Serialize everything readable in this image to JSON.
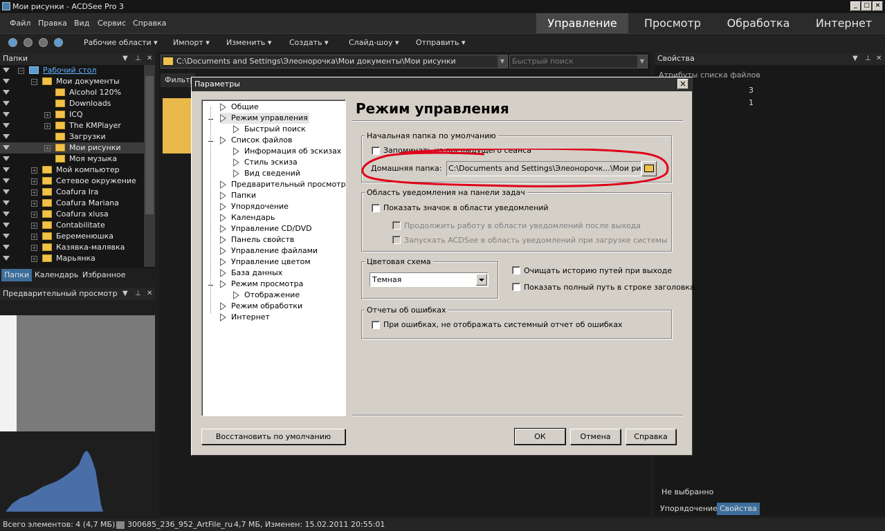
{
  "window": {
    "title": "Мои рисунки - ACDSee Pro 3",
    "min": "_",
    "max": "□",
    "close": "×"
  },
  "menu": [
    "Файл",
    "Правка",
    "Вид",
    "Сервис",
    "Справка"
  ],
  "mode_tabs": [
    "Управление",
    "Просмотр",
    "Обработка",
    "Интернет"
  ],
  "toolbar": [
    "Рабочие области ▾",
    "Импорт ▾",
    "Изменить ▾",
    "Создать ▾",
    "Слайд-шоу ▾",
    "Отправить ▾"
  ],
  "folders": {
    "title": "Папки",
    "items": [
      {
        "label": "Рабочий стол",
        "level": 0,
        "link": true
      },
      {
        "label": "Мои документы",
        "level": 1
      },
      {
        "label": "Alcohol 120%",
        "level": 2
      },
      {
        "label": "Downloads",
        "level": 2
      },
      {
        "label": "ICQ",
        "level": 2
      },
      {
        "label": "The KMPlayer",
        "level": 2
      },
      {
        "label": "Загрузки",
        "level": 2
      },
      {
        "label": "Мои рисунки",
        "level": 2,
        "selected": true
      },
      {
        "label": "Моя музыка",
        "level": 2
      },
      {
        "label": "Мой компьютер",
        "level": 1
      },
      {
        "label": "Сетевое окружение",
        "level": 1
      },
      {
        "label": "Coafura Ira",
        "level": 1
      },
      {
        "label": "Coafura Mariana",
        "level": 1
      },
      {
        "label": "Coafura xiusa",
        "level": 1
      },
      {
        "label": "Contabilitate",
        "level": 1
      },
      {
        "label": "Беременюшка",
        "level": 1
      },
      {
        "label": "Казявка-малявка",
        "level": 1
      },
      {
        "label": "Марьянка",
        "level": 1
      }
    ],
    "tabs": [
      "Папки",
      "Календарь",
      "Избранное"
    ]
  },
  "preview": {
    "title": "Предварительный просмотр"
  },
  "path": {
    "value": "C:\\Documents and Settings\\Элеонорочка\\Мои документы\\Мои рисунки",
    "filter": "Фильтр",
    "search_placeholder": "Быстрый поиск"
  },
  "properties": {
    "title": "Свойства",
    "section": "Атрибуты списка файлов",
    "v1": "3",
    "v2": "1",
    "none": "Не выбранно",
    "tabs": [
      "Упорядочение",
      "Свойства"
    ]
  },
  "status": {
    "count": "Всего элементов: 4  (4,7 МБ)",
    "file": "300685_236_952_ArtFile_ru",
    "info": "4,7 МБ, Изменен: 15.02.2011 20:55:01"
  },
  "dialog": {
    "title": "Параметры",
    "close": "×",
    "heading": "Режим управления",
    "nav": [
      {
        "label": "Общие",
        "level": 0
      },
      {
        "label": "Режим управления",
        "level": 0,
        "selected": true
      },
      {
        "label": "Быстрый поиск",
        "level": 1
      },
      {
        "label": "Список файлов",
        "level": 0
      },
      {
        "label": "Информация об эскизах",
        "level": 1
      },
      {
        "label": "Стиль эскиза",
        "level": 1
      },
      {
        "label": "Вид сведений",
        "level": 1
      },
      {
        "label": "Предварительный просмотр",
        "level": 0
      },
      {
        "label": "Папки",
        "level": 0
      },
      {
        "label": "Упорядочение",
        "level": 0
      },
      {
        "label": "Календарь",
        "level": 0
      },
      {
        "label": "Управление CD/DVD",
        "level": 0
      },
      {
        "label": "Панель свойств",
        "level": 0
      },
      {
        "label": "Управление файлами",
        "level": 0
      },
      {
        "label": "Управление цветом",
        "level": 0
      },
      {
        "label": "База данных",
        "level": 0
      },
      {
        "label": "Режим просмотра",
        "level": 0
      },
      {
        "label": "Отображение",
        "level": 1
      },
      {
        "label": "Режим обработки",
        "level": 0
      },
      {
        "label": "Интернет",
        "level": 0
      }
    ],
    "grp_start": "Начальная папка по умолчанию",
    "remember": "Запоминать из предыдущего сеанса",
    "home_label": "Домашняя папка:",
    "home_value": "C:\\Documents and Settings\\Элеонорочк...\\Мои рисунки",
    "grp_tray": "Область уведомления на панели задач",
    "tray_show": "Показать значок в области уведомлений",
    "tray_continue": "Продолжить работу в области уведомлений после выхода",
    "tray_launch": "Запускать ACDSee в область уведомлений при загрузке системы",
    "grp_color": "Цветовая схема",
    "color_value": "Темная",
    "clear_history": "Очищать историю путей при выходе",
    "full_path": "Показать полный путь в строке заголовка",
    "grp_errors": "Отчеты об ошибках",
    "errors_opt": "При ошибках, не отображать системный отчет об ошибках",
    "btn_restore": "Восстановить по умолчанию",
    "btn_ok": "ОК",
    "btn_cancel": "Отмена",
    "btn_help": "Справка",
    "annotation_color": "#e0001a"
  }
}
